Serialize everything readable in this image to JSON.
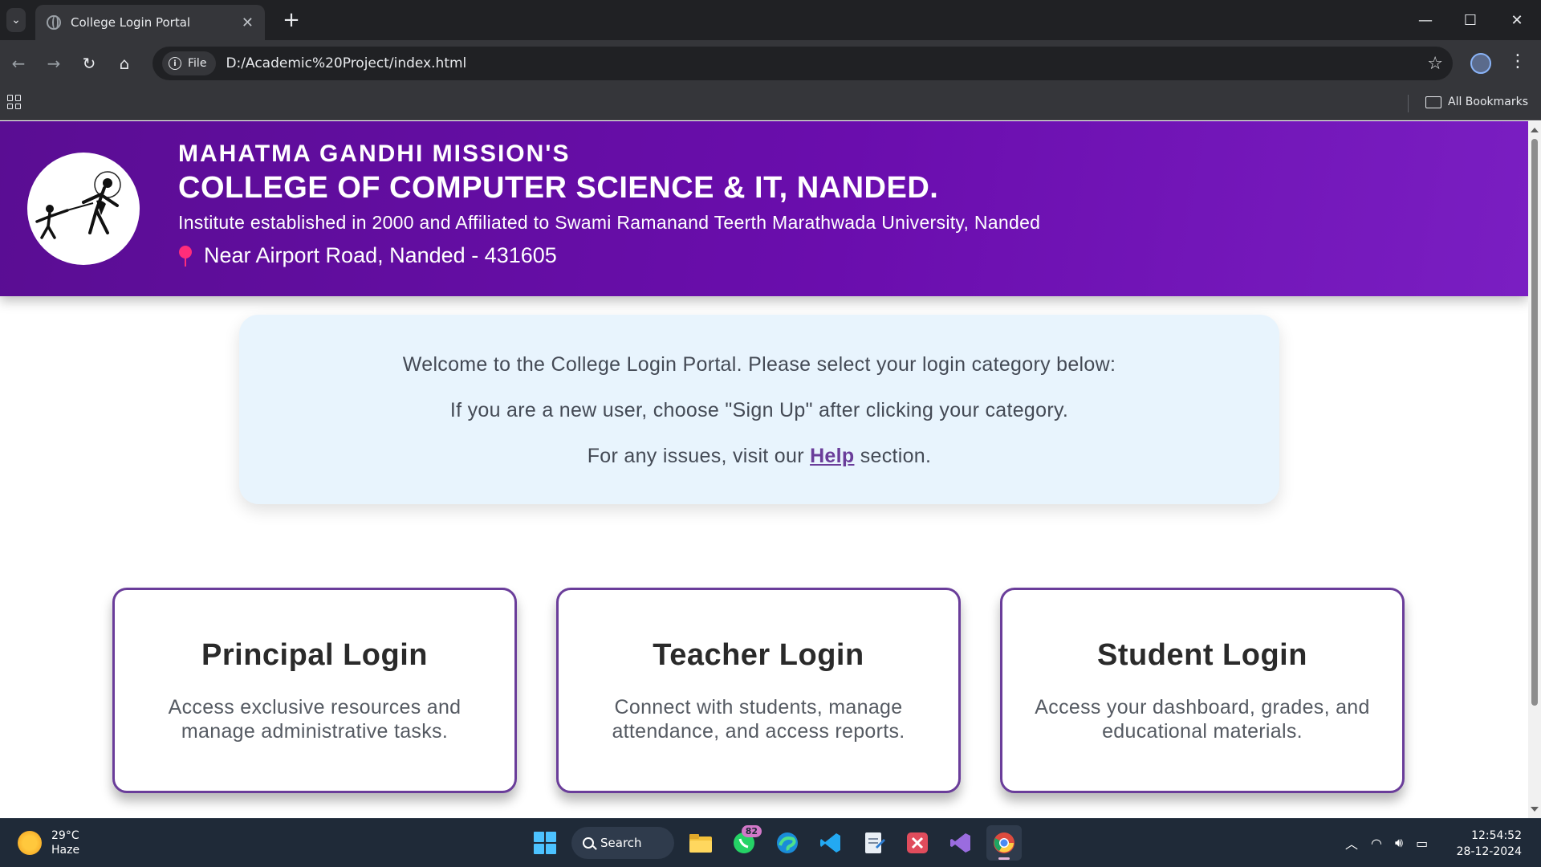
{
  "browser": {
    "tab_title": "College Login Portal",
    "tab_close": "✕",
    "new_tab": "+",
    "security_chip": "File",
    "url": "D:/Academic%20Project/index.html",
    "bookmarks_label": "All Bookmarks",
    "window_controls": {
      "minimize": "—",
      "maximize": "☐",
      "close": "✕"
    }
  },
  "header": {
    "line1": "MAHATMA GANDHI MISSION'S",
    "line2": "COLLEGE OF COMPUTER SCIENCE & IT, NANDED.",
    "line3": "Institute established in 2000 and Affiliated to Swami Ramanand Teerth Marathwada University, Nanded",
    "address": "Near Airport Road, Nanded - 431605"
  },
  "welcome": {
    "line1": "Welcome to the College Login Portal. Please select your login category below:",
    "line2": "If you are a new user, choose \"Sign Up\" after clicking your category.",
    "line3_before": "For any issues, visit our ",
    "help_link": "Help",
    "line3_after": " section."
  },
  "cards": [
    {
      "title": "Principal Login",
      "description": "Access exclusive resources and manage administrative tasks."
    },
    {
      "title": "Teacher Login",
      "description": "Connect with students, manage attendance, and access reports."
    },
    {
      "title": "Student Login",
      "description": "Access your dashboard, grades, and educational materials."
    }
  ],
  "taskbar": {
    "weather_temp": "29°C",
    "weather_desc": "Haze",
    "search_label": "Search",
    "whatsapp_badge": "82",
    "time": "12:54:52",
    "date": "28-12-2024"
  },
  "colors": {
    "header_purple": "#6a0dad",
    "card_border": "#6a3d9a",
    "welcome_bg": "#e8f4fd",
    "address_pin": "#ff2d7a"
  }
}
